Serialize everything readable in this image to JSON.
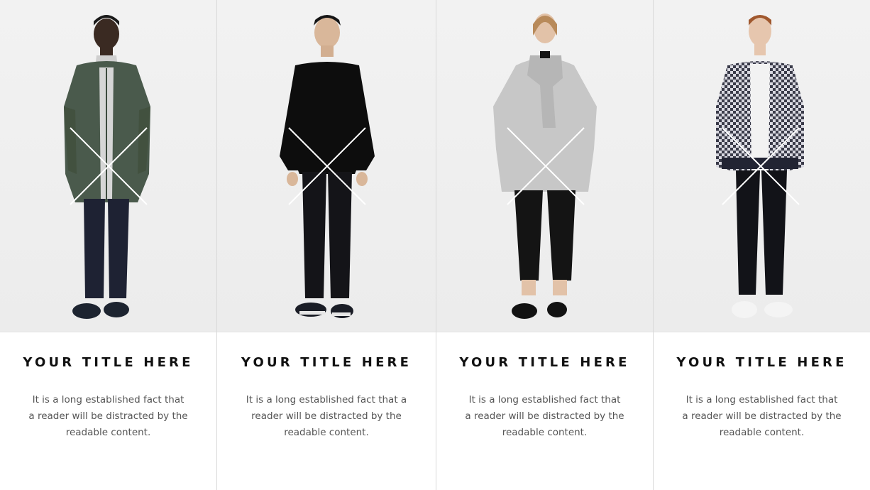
{
  "cards": [
    {
      "image_label": "model-green-coat",
      "title": "YOUR TITLE HERE",
      "description": "It is a long established fact that a reader will be distracted by the readable content."
    },
    {
      "image_label": "model-black-sweater",
      "title": "YOUR TITLE HERE",
      "description": "It is a long established fact that a reader will be distracted by the readable content."
    },
    {
      "image_label": "model-grey-coat",
      "title": "YOUR TITLE HERE",
      "description": "It is a long established fact that a reader will be distracted by the readable content."
    },
    {
      "image_label": "model-patterned-bomber",
      "title": "YOUR TITLE HERE",
      "description": "It is a long established fact that a reader will be distracted by the readable content."
    }
  ],
  "colors": {
    "title": "#111111",
    "body_text": "#555555",
    "photo_bg": "#efefef",
    "divider": "#d9d9d9",
    "placeholder_cross": "#ffffff"
  },
  "icons": {
    "placeholder": "image-placeholder-x-icon"
  }
}
